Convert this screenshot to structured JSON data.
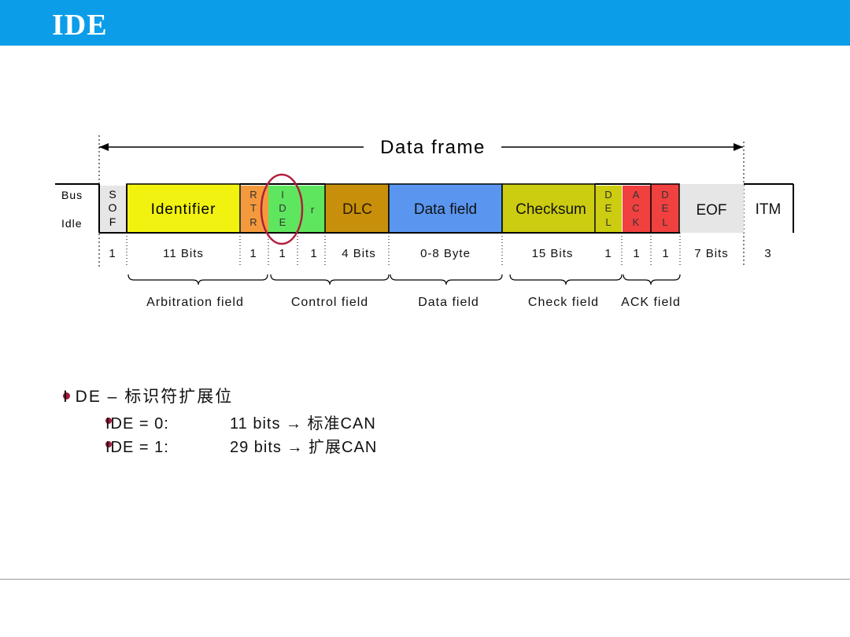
{
  "header": {
    "title": "IDE"
  },
  "diagram": {
    "frame_label": "Data frame",
    "bus_idle": [
      "Bus",
      "Idle"
    ],
    "fields": [
      {
        "label": "S O F",
        "color": "#e6e6e6",
        "bits": "1"
      },
      {
        "label": "Identifier",
        "color": "#f2f210",
        "bits": "11 Bits"
      },
      {
        "label": "R T R",
        "color": "#f59a3c",
        "bits": "1"
      },
      {
        "label": "I D E",
        "color": "#5fe65f",
        "bits": "1"
      },
      {
        "label": "r",
        "color": "#5fe65f",
        "bits": "1"
      },
      {
        "label": "DLC",
        "color": "#c8900a",
        "bits": "4 Bits"
      },
      {
        "label": "Data field",
        "color": "#5a96f0",
        "bits": "0-8 Byte"
      },
      {
        "label": "Checksum",
        "color": "#cccc10",
        "bits": "15 Bits"
      },
      {
        "label": "D E L",
        "color": "#cccc10",
        "bits": "1"
      },
      {
        "label": "A C K",
        "color": "#f04040",
        "bits": "1"
      },
      {
        "label": "D E L",
        "color": "#f04040",
        "bits": "1"
      },
      {
        "label": "EOF",
        "color": "#e6e6e6",
        "bits": "7 Bits"
      },
      {
        "label": "ITM",
        "color": "#ffffff",
        "bits": "3"
      }
    ],
    "groups": [
      "Arbitration field",
      "Control field",
      "Data field",
      "Check field",
      "ACK field"
    ],
    "highlight_color": "#b01f3c"
  },
  "bullets": {
    "main": "I DE – 标识符扩展位",
    "items": [
      {
        "code": "IDE =  0:",
        "desc": "11 bits → 标准CAN"
      },
      {
        "code": "IDE =  1:",
        "desc": "29 bits → 扩展CAN"
      }
    ]
  }
}
